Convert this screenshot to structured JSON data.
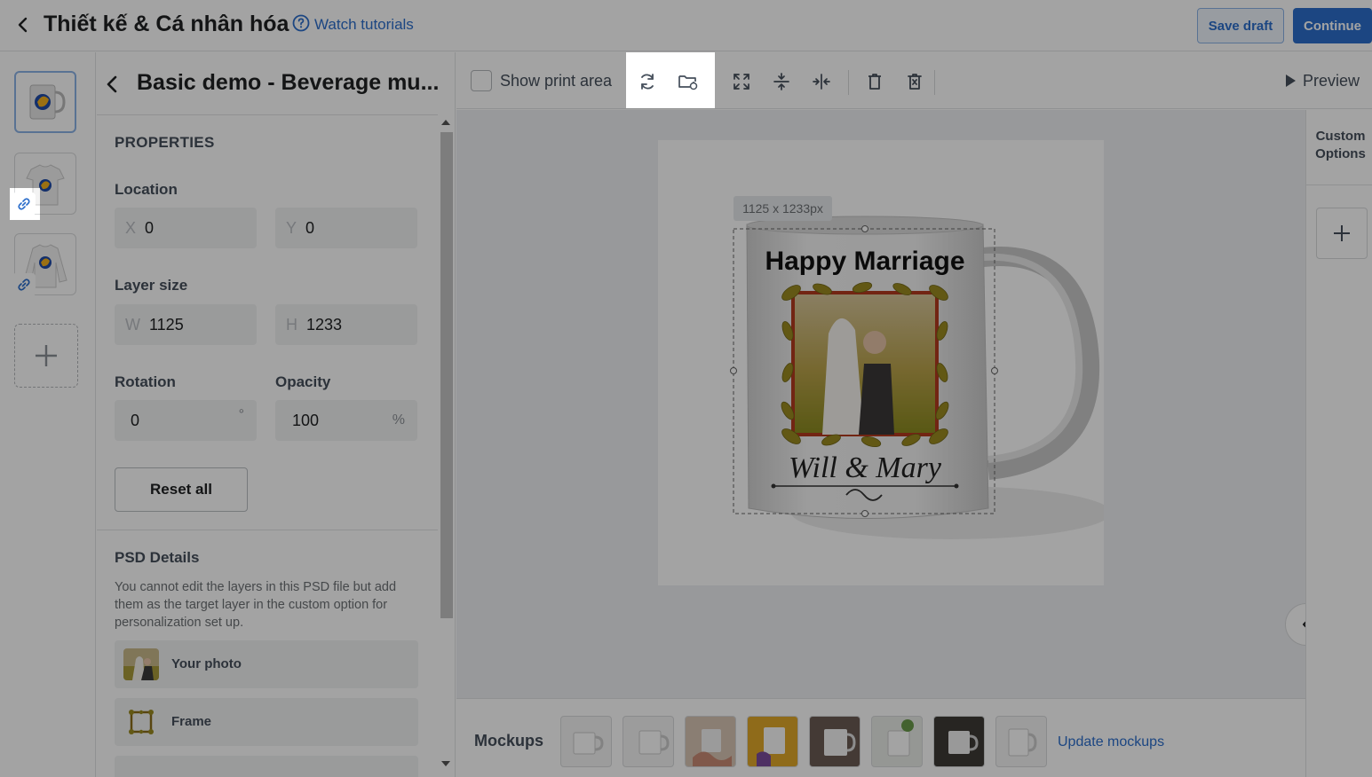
{
  "header": {
    "title": "Thiết kế & Cá nhân hóa",
    "tutorials_label": "Watch tutorials",
    "save_draft_label": "Save draft",
    "continue_label": "Continue"
  },
  "properties": {
    "product_title": "Basic demo - Beverage mu...",
    "section_heading": "PROPERTIES",
    "location_label": "Location",
    "x_prefix": "X",
    "x_value": "0",
    "y_prefix": "Y",
    "y_value": "0",
    "layer_size_label": "Layer size",
    "w_prefix": "W",
    "w_value": "1125",
    "h_prefix": "H",
    "h_value": "1233",
    "rotation_label": "Rotation",
    "rotation_value": "0",
    "rotation_unit": "°",
    "opacity_label": "Opacity",
    "opacity_value": "100",
    "opacity_unit": "%",
    "reset_label": "Reset all",
    "psd_heading": "PSD Details",
    "psd_description": "You cannot edit the layers in this PSD file but add them as the target layer in the custom option for personalization set up.",
    "layers": [
      {
        "name": "Your photo",
        "icon": "photo-thumbnail"
      },
      {
        "name": "Frame",
        "icon": "frame-icon"
      }
    ]
  },
  "toolbar": {
    "show_print_area_label": "Show print area",
    "show_print_area_checked": false,
    "preview_label": "Preview",
    "tools": [
      "replace-icon",
      "change-folder-icon",
      "fit-icon",
      "align-vertical-icon",
      "align-horizontal-icon",
      "delete-icon",
      "delete-all-icon"
    ]
  },
  "canvas": {
    "dimension_tag": "1125 x 1233px",
    "mug_top_text": "Happy Marriage",
    "mug_bottom_text": "Will & Mary"
  },
  "custom_options": {
    "title": "Custom Options"
  },
  "mockups": {
    "label": "Mockups",
    "update_label": "Update mockups",
    "count": 8
  },
  "colors": {
    "primary": "#2c6ecb",
    "text": "#202223",
    "muted": "#454f5b"
  }
}
